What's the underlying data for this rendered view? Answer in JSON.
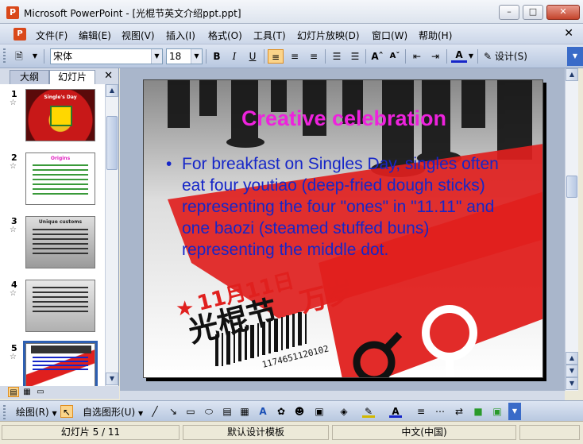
{
  "window": {
    "title": "Microsoft PowerPoint - [光棍节英文介绍ppt.ppt]",
    "app_icon": "powerpoint-icon"
  },
  "menubar": {
    "items": [
      "文件(F)",
      "编辑(E)",
      "视图(V)",
      "插入(I)",
      "格式(O)",
      "工具(T)",
      "幻灯片放映(D)",
      "窗口(W)",
      "帮助(H)"
    ]
  },
  "toolbar": {
    "font_name": "宋体",
    "font_size": "18",
    "bold": "B",
    "italic": "I",
    "underline": "U",
    "design_label": "设计(S)"
  },
  "left_panel": {
    "tabs": [
      "大纲",
      "幻灯片"
    ],
    "active_tab": "幻灯片",
    "thumbnails": [
      {
        "num": "1",
        "caption": "Single's Day"
      },
      {
        "num": "2",
        "caption": "Origins"
      },
      {
        "num": "3",
        "caption": "Unique customs"
      },
      {
        "num": "4",
        "caption": ""
      },
      {
        "num": "5",
        "caption": ""
      }
    ],
    "selected": "5"
  },
  "slide": {
    "title": "Creative celebration",
    "bullet": "For breakfast on Singles Day, singles often eat four youtiao (deep-fried dough sticks) representing the four \"ones\" in \"11.11\" and one baozi (steamed stuffed buns) representing the middle dot.",
    "image_text": {
      "date": "11月11日",
      "festival": "光棍节",
      "slogan": "万岁",
      "barcode_digits": "1174651120102"
    }
  },
  "drawbar": {
    "draw_label": "绘图(R)",
    "autoshape_label": "自选图形(U)"
  },
  "statusbar": {
    "slide_info": "幻灯片 5 / 11",
    "design": "默认设计模板",
    "language": "中文(中国)"
  },
  "colors": {
    "title_magenta": "#ee22dd",
    "body_blue": "#1626c8",
    "banner_red": "#e0201e"
  }
}
